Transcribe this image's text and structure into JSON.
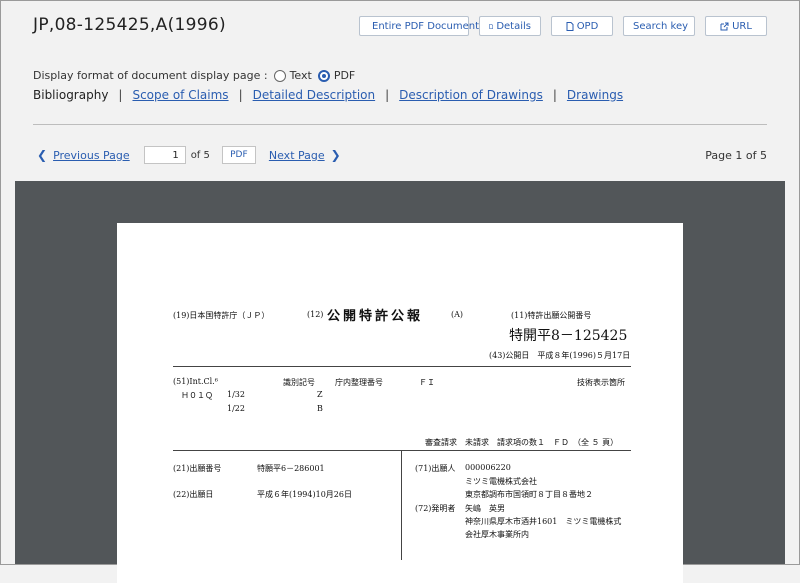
{
  "header": {
    "title": "JP,08-125425,A(1996)",
    "buttons": {
      "entire_pdf": "Entire PDF Document",
      "details": "Details",
      "opd": "OPD",
      "search_key": "Search key",
      "url": "URL"
    }
  },
  "display_format": {
    "label": "Display format of document display page :",
    "options": [
      "Text",
      "PDF"
    ],
    "selected": "PDF"
  },
  "nav": {
    "bibliography": "Bibliography",
    "links": [
      "Scope of Claims",
      "Detailed Description",
      "Description of Drawings",
      "Drawings"
    ],
    "separator": "|"
  },
  "pager": {
    "previous": "Previous Page",
    "page_value": "1",
    "of_total": "of 5",
    "pdf": "PDF",
    "next": "Next Page",
    "page_info": "Page 1 of 5"
  },
  "document": {
    "country": "(19)日本国特許庁（ＪＰ）",
    "kind_code": "(12)",
    "kind": "公開特許公報",
    "kind_suffix": "(A)",
    "pub_no_label": "(11)特許出願公開番号",
    "pub_no": "特開平8－125425",
    "pub_date": "(43)公開日　平成８年(1996)５月17日",
    "intcl_label": "(51)Int.Cl.⁶",
    "id_code_label": "識別記号",
    "office_ref_label": "庁内整理番号",
    "fi_label": "ＦＩ",
    "tech_label": "技術表示箇所",
    "class_main": "Ｈ０１Ｑ",
    "class_rows": [
      {
        "code": "1/32",
        "id": "Z"
      },
      {
        "code": "1/22",
        "id": "B"
      }
    ],
    "exam": "審査請求　未請求　請求項の数１　ＦＤ　（全 ５ 頁）",
    "app_no_label": "(21)出願番号",
    "app_no": "特願平6－286001",
    "app_date_label": "(22)出願日",
    "app_date": "平成６年(1994)10月26日",
    "applicant_label": "(71)出願人",
    "applicant_id": "000006220",
    "applicant_name": "ミツミ電機株式会社",
    "applicant_addr": "東京都調布市国領町８丁目８番地２",
    "inventor_label": "(72)発明者",
    "inventor_name": "矢嶋　英男",
    "inventor_addr1": "神奈川県厚木市酒井1601　ミツミ電機株式",
    "inventor_addr2": "会社厚木事業所内"
  }
}
